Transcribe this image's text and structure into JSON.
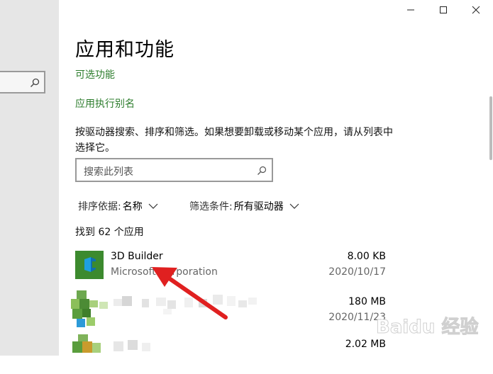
{
  "window": {
    "minimize_icon": "minimize-icon",
    "maximize_icon": "maximize-icon",
    "close_icon": "close-icon"
  },
  "left_pane": {
    "search_icon": "search-icon"
  },
  "page": {
    "title": "应用和功能",
    "optional_features_link": "可选功能",
    "app_aliases_link": "应用执行别名",
    "description": "按驱动器搜索、排序和筛选。如果想要卸载或移动某个应用，请从列表中选择它。"
  },
  "search": {
    "placeholder": "搜索此列表"
  },
  "sort": {
    "label": "排序依据:",
    "value": "名称"
  },
  "filter": {
    "label": "筛选条件:",
    "value": "所有驱动器"
  },
  "result_count": "找到 62 个应用",
  "apps": [
    {
      "name": "3D Builder",
      "publisher": "Microsoft Corporation",
      "size": "8.00 KB",
      "date": "2020/10/17",
      "icon": "3d-builder-icon",
      "color": "#3c8a2e"
    },
    {
      "name": "",
      "publisher": "",
      "size": "180 MB",
      "date": "2020/11/23",
      "icon": "pixelated-app-icon"
    },
    {
      "name": "",
      "publisher": "",
      "size": "2.02 MB",
      "date": "",
      "icon": "pixelated-app-icon"
    }
  ],
  "annotation": {
    "arrow_color": "#e02020"
  },
  "watermark": {
    "text": "Baidu 经验"
  },
  "colors": {
    "link": "#2d7d2d",
    "left_pane": "#e6e6e6"
  }
}
